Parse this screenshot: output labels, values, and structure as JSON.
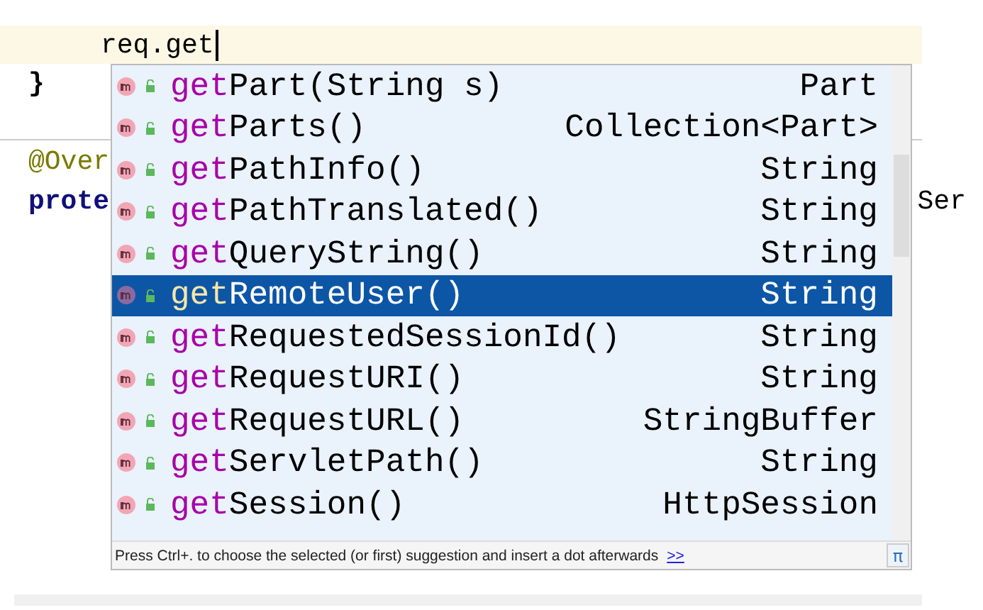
{
  "editor": {
    "current_line": "req.get",
    "closing_brace": "}",
    "annotation": "@Over",
    "keyword": "prote",
    "trailing": "Ser"
  },
  "suggestions": [
    {
      "prefix": "get",
      "rest": "Part(String s)",
      "type": "Part",
      "selected": false
    },
    {
      "prefix": "get",
      "rest": "Parts()",
      "type": "Collection<Part>",
      "selected": false
    },
    {
      "prefix": "get",
      "rest": "PathInfo()",
      "type": "String",
      "selected": false
    },
    {
      "prefix": "get",
      "rest": "PathTranslated()",
      "type": "String",
      "selected": false
    },
    {
      "prefix": "get",
      "rest": "QueryString()",
      "type": "String",
      "selected": false
    },
    {
      "prefix": "get",
      "rest": "RemoteUser()",
      "type": "String",
      "selected": true
    },
    {
      "prefix": "get",
      "rest": "RequestedSessionId()",
      "type": "String",
      "selected": false
    },
    {
      "prefix": "get",
      "rest": "RequestURI()",
      "type": "String",
      "selected": false
    },
    {
      "prefix": "get",
      "rest": "RequestURL()",
      "type": "StringBuffer",
      "selected": false
    },
    {
      "prefix": "get",
      "rest": "ServletPath()",
      "type": "String",
      "selected": false
    },
    {
      "prefix": "get",
      "rest": "Session()",
      "type": "HttpSession",
      "selected": false
    }
  ],
  "footer": {
    "hint": "Press Ctrl+. to choose the selected (or first) suggestion and insert a dot afterwards",
    "link": ">>",
    "pi_button": "π"
  }
}
